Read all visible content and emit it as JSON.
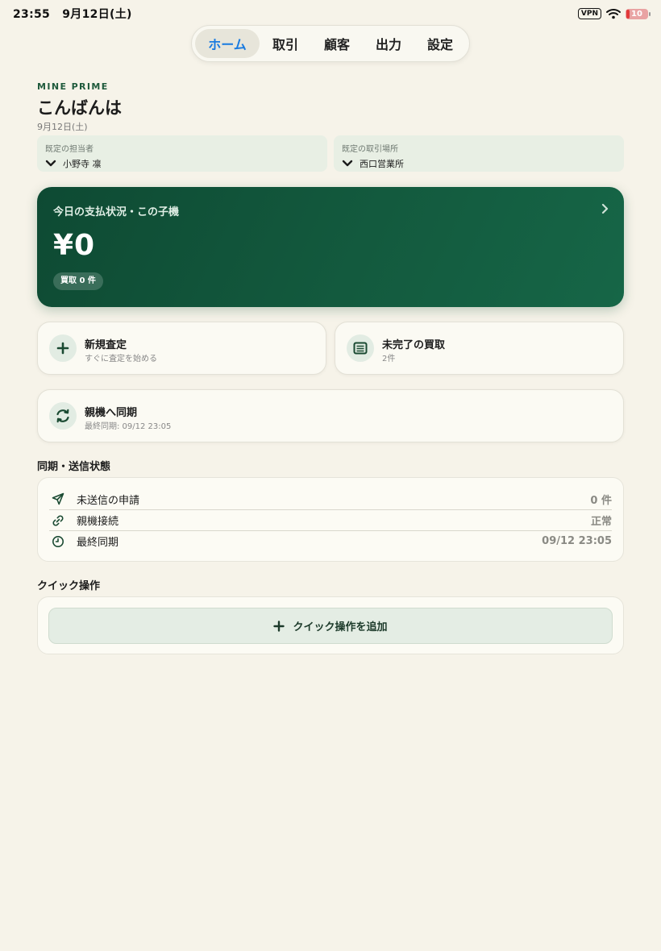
{
  "statusbar": {
    "time": "23:55",
    "date": "9月12日(土)",
    "vpn": "VPN",
    "battery": "10"
  },
  "tabs": [
    {
      "label": "ホーム",
      "active": true
    },
    {
      "label": "取引"
    },
    {
      "label": "顧客"
    },
    {
      "label": "出力"
    },
    {
      "label": "設定"
    }
  ],
  "header": {
    "brand": "MINE PRIME",
    "greeting": "こんばんは",
    "date": "9月12日(土)"
  },
  "selectors": {
    "staff": {
      "label": "既定の担当者",
      "value": "小野寺 凛"
    },
    "place": {
      "label": "既定の取引場所",
      "value": "西口営業所"
    }
  },
  "hero": {
    "title": "今日の支払状況・この子機",
    "amount": "¥0",
    "badge": "買取 0 件"
  },
  "actions": {
    "new_appraisal": {
      "title": "新規査定",
      "subtitle": "すぐに査定を始める"
    },
    "pending": {
      "title": "未完了の買取",
      "subtitle": "2件"
    },
    "sync": {
      "title": "親機へ同期",
      "subtitle": "最終同期: 09/12 23:05"
    }
  },
  "sync_status": {
    "title": "同期・送信状態",
    "rows": [
      {
        "label": "未送信の申請",
        "value": "0 件",
        "icon": "send-icon"
      },
      {
        "label": "親機接続",
        "value": "正常",
        "icon": "link-icon"
      },
      {
        "label": "最終同期",
        "value": "09/12 23:05",
        "icon": "clock-icon"
      }
    ]
  },
  "quick": {
    "title": "クイック操作",
    "add_label": "クイック操作を追加"
  },
  "colors": {
    "accent": "#1a7be0",
    "brand_green": "#135a3e",
    "background": "#f6f3e9"
  }
}
